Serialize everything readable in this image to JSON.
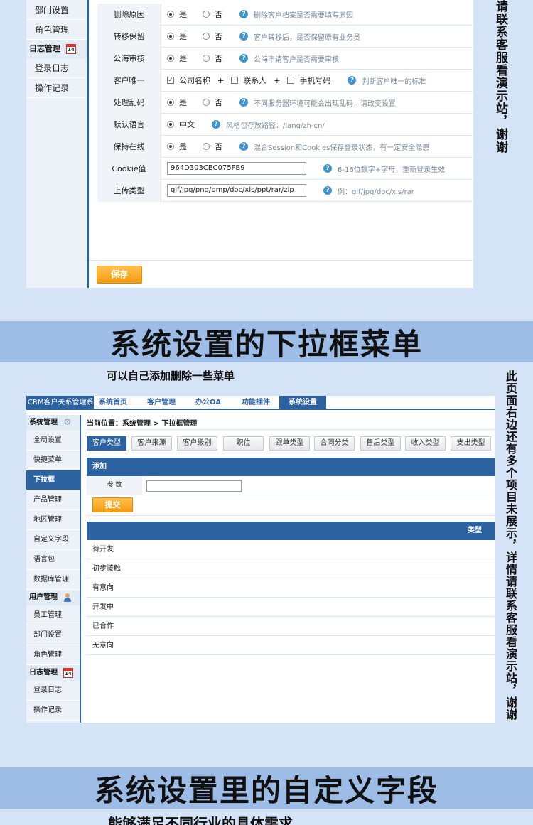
{
  "panel1": {
    "sidebar": [
      {
        "type": "item",
        "label": "部门设置"
      },
      {
        "type": "item",
        "label": "角色管理"
      },
      {
        "type": "head",
        "label": "日志管理",
        "icon": "calendar-icon",
        "icon_text": "14"
      },
      {
        "type": "item",
        "label": "登录日志"
      },
      {
        "type": "item",
        "label": "操作记录"
      }
    ],
    "rows": [
      {
        "label": "删除原因",
        "yes": "是",
        "no": "否",
        "hint": "删除客户档案是否需要填写原因"
      },
      {
        "label": "转移保留",
        "yes": "是",
        "no": "否",
        "hint": "客户转移后，是否保留原有业务员"
      },
      {
        "label": "公海审核",
        "yes": "是",
        "no": "否",
        "hint": "公海申请客户是否需要审核"
      },
      {
        "label": "客户唯一",
        "opt1": "公司名称",
        "plus": "+",
        "opt2": "联系人",
        "opt3": "手机号码",
        "hint": "判断客户唯一的标准"
      },
      {
        "label": "处理乱码",
        "yes": "是",
        "no": "否",
        "hint": "不同服务器环境可能会出现乱码，请改变设置"
      },
      {
        "label": "默认语言",
        "value": "中文",
        "hint": "风格包存放路径：/lang/zh-cn/"
      },
      {
        "label": "保持在线",
        "yes": "是",
        "no": "否",
        "hint": "混合Session和Cookies保存登录状态，有一定安全隐患"
      },
      {
        "label": "Cookie值",
        "input": "964D303CBC075FB9",
        "hint": "6-16位数字+字母，重新登录生效"
      },
      {
        "label": "上传类型",
        "input": "gif/jpg/png/bmp/doc/xls/ppt/rar/zip",
        "hint": "例：gif/jpg/doc/xls/rar"
      }
    ],
    "save_label": "保存"
  },
  "vertical_note_1": "请联系客服看演示站，谢谢",
  "banner1": "系统设置的下拉框菜单",
  "caption1": "可以自己添加删除一些菜单",
  "panel2": {
    "logo": "CRM客户关系管理系统",
    "nav": [
      "系统首页",
      "客户管理",
      "办公OA",
      "功能插件",
      "系统设置"
    ],
    "sidebar": [
      {
        "type": "head",
        "label": "系统管理",
        "icon": "gear-icon"
      },
      {
        "type": "item",
        "label": "全局设置"
      },
      {
        "type": "item",
        "label": "快捷菜单"
      },
      {
        "type": "item",
        "label": "下拉框",
        "active": true
      },
      {
        "type": "item",
        "label": "产品管理"
      },
      {
        "type": "item",
        "label": "地区管理"
      },
      {
        "type": "item",
        "label": "自定义字段"
      },
      {
        "type": "item",
        "label": "语言包"
      },
      {
        "type": "item",
        "label": "数据库管理"
      },
      {
        "type": "head",
        "label": "用户管理",
        "icon": "user-icon"
      },
      {
        "type": "item",
        "label": "员工管理"
      },
      {
        "type": "item",
        "label": "部门设置"
      },
      {
        "type": "item",
        "label": "角色管理"
      },
      {
        "type": "head",
        "label": "日志管理",
        "icon": "calendar-icon",
        "icon_text": "14"
      },
      {
        "type": "item",
        "label": "登录日志"
      },
      {
        "type": "item",
        "label": "操作记录"
      }
    ],
    "breadcrumb": "当前位置：系统管理 > 下拉框管理",
    "tabs": [
      "客户类型",
      "客户来源",
      "客户级别",
      "职位",
      "跟单类型",
      "合同分类",
      "售后类型",
      "收入类型",
      "支出类型"
    ],
    "add_title": "添加",
    "param_label": "参 数",
    "param_value": "",
    "submit_label": "提交",
    "list_header": "类型",
    "list_items": [
      "待开发",
      "初步接触",
      "有意向",
      "开发中",
      "已合作",
      "无意向"
    ]
  },
  "vertical_note_2": "此页面右边还有多个项目未展示，详情请联系客服看演示站，谢谢",
  "banner2": "系统设置里的自定义字段",
  "caption2": "能够满足不同行业的具体需求"
}
